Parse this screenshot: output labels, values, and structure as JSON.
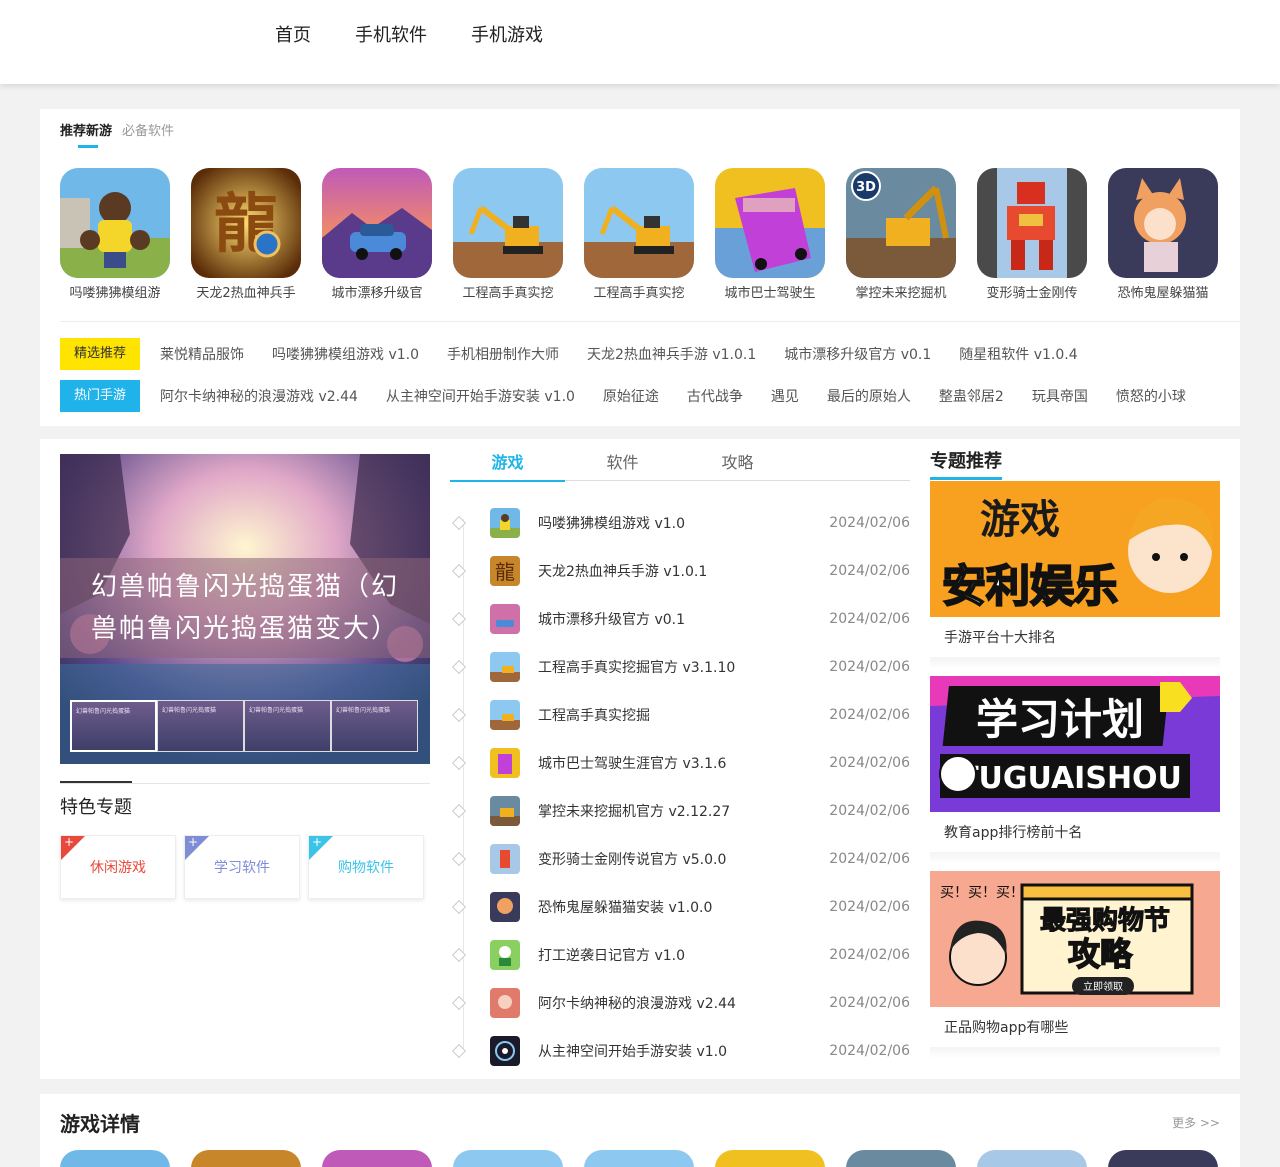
{
  "nav": {
    "items": [
      "首页",
      "手机软件",
      "手机游戏"
    ]
  },
  "recommend": {
    "tabs": [
      "推荐新游",
      "必备软件"
    ],
    "apps": [
      {
        "name": "吗喽狒狒模组游",
        "icon": "gorilla-game-icon"
      },
      {
        "name": "天龙2热血神兵手",
        "icon": "dragon-game-icon"
      },
      {
        "name": "城市漂移升级官",
        "icon": "car-drift-icon"
      },
      {
        "name": "工程高手真实挖",
        "icon": "excavator-icon"
      },
      {
        "name": "工程高手真实挖",
        "icon": "excavator-icon"
      },
      {
        "name": "城市巴士驾驶生",
        "icon": "bus-icon"
      },
      {
        "name": "掌控未来挖掘机",
        "icon": "excavator-3d-icon"
      },
      {
        "name": "变形骑士金刚传",
        "icon": "robot-icon"
      },
      {
        "name": "恐怖鬼屋躲猫猫",
        "icon": "cat-girl-icon"
      }
    ],
    "featured_label": "精选推荐",
    "featured_links": [
      "莱悦精品服饰",
      "吗喽狒狒模组游戏 v1.0",
      "手机相册制作大师",
      "天龙2热血神兵手游 v1.0.1",
      "城市漂移升级官方 v0.1",
      "随星租软件 v1.0.4"
    ],
    "hot_label": "热门手游",
    "hot_links": [
      "阿尔卡纳神秘的浪漫游戏 v2.44",
      "从主神空间开始手游安装 v1.0",
      "原始征途",
      "古代战争",
      "遇见",
      "最后的原始人",
      "整蛊邻居2",
      "玩具帝国",
      "愤怒的小球"
    ]
  },
  "slider": {
    "title": "幻兽帕鲁闪光捣蛋猫（幻兽帕鲁闪光捣蛋猫变大）",
    "thumbs": [
      "幻兽帕鲁闪光捣蛋猫",
      "幻兽帕鲁闪光捣蛋猫",
      "幻兽帕鲁闪光捣蛋猫",
      "幻兽帕鲁闪光捣蛋猫"
    ]
  },
  "features": {
    "title": "特色专题",
    "cards": [
      {
        "label": "休闲游戏",
        "color": "#e8493a"
      },
      {
        "label": "学习软件",
        "color": "#7f8cd6"
      },
      {
        "label": "购物软件",
        "color": "#3cc4e8"
      }
    ]
  },
  "middle": {
    "tabs": [
      "游戏",
      "软件",
      "攻略"
    ],
    "list": [
      {
        "title": "吗喽狒狒模组游戏 v1.0",
        "date": "2024/02/06",
        "icon": "gorilla-game-icon"
      },
      {
        "title": "天龙2热血神兵手游 v1.0.1",
        "date": "2024/02/06",
        "icon": "dragon-game-icon"
      },
      {
        "title": "城市漂移升级官方 v0.1",
        "date": "2024/02/06",
        "icon": "car-drift-icon"
      },
      {
        "title": "工程高手真实挖掘官方 v3.1.10",
        "date": "2024/02/06",
        "icon": "excavator-icon"
      },
      {
        "title": "工程高手真实挖掘",
        "date": "2024/02/06",
        "icon": "excavator-icon"
      },
      {
        "title": "城市巴士驾驶生涯官方 v3.1.6",
        "date": "2024/02/06",
        "icon": "bus-icon"
      },
      {
        "title": "掌控未来挖掘机官方 v2.12.27",
        "date": "2024/02/06",
        "icon": "excavator-3d-icon"
      },
      {
        "title": "变形骑士金刚传说官方 v5.0.0",
        "date": "2024/02/06",
        "icon": "robot-icon"
      },
      {
        "title": "恐怖鬼屋躲猫猫安装 v1.0.0",
        "date": "2024/02/06",
        "icon": "cat-girl-icon"
      },
      {
        "title": "打工逆袭日记官方 v1.0",
        "date": "2024/02/06",
        "icon": "worker-icon"
      },
      {
        "title": "阿尔卡纳神秘的浪漫游戏 v2.44",
        "date": "2024/02/06",
        "icon": "arcana-icon"
      },
      {
        "title": "从主神空间开始手游安装 v1.0",
        "date": "2024/02/06",
        "icon": "space-icon"
      }
    ]
  },
  "topics": {
    "title": "专题推荐",
    "cards": [
      {
        "caption": "手游平台十大排名",
        "banner_line1": "游戏",
        "banner_line2": "安利娱乐"
      },
      {
        "caption": "教育app排行榜前十名",
        "banner_line1": "学习计划",
        "banner_line2": "TUGUAISHOU"
      },
      {
        "caption": "正品购物app有哪些",
        "banner_line1": "最强购物节",
        "banner_line2": "攻略",
        "banner_small": "立即领取",
        "banner_tag": "买！买！买！"
      }
    ]
  },
  "details": {
    "title": "游戏详情",
    "more": "更多 >>"
  },
  "colors": {
    "accent": "#1fb5e8",
    "yellow_badge": "#ffe400"
  }
}
